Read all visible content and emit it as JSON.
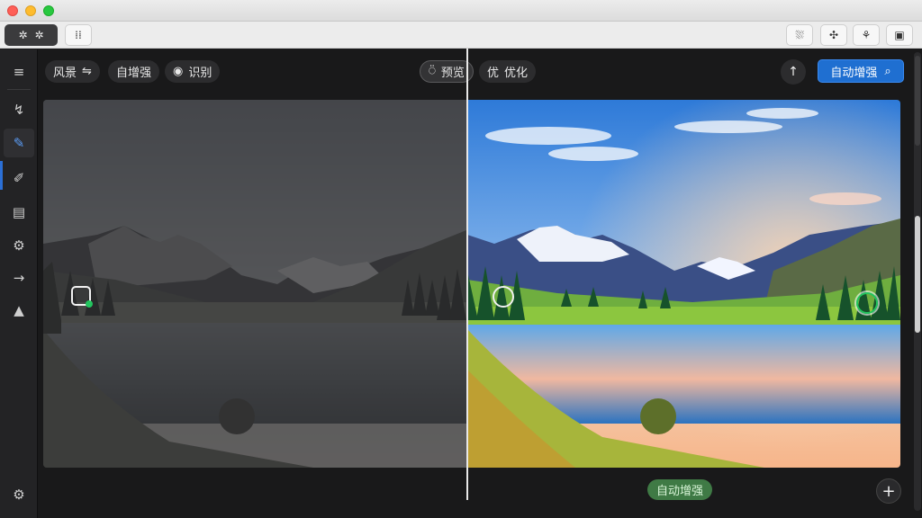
{
  "toolbar": {
    "group_icons": [
      "✲",
      "✲"
    ],
    "single_icon": "⁞⁞",
    "right_icons": [
      "⛆",
      "✣",
      "⚘",
      "▣"
    ]
  },
  "sidebar": {
    "items": [
      {
        "icon": "≡",
        "name": "menu-icon"
      },
      {
        "icon": "↯",
        "name": "adjust-icon"
      },
      {
        "icon": "✎",
        "name": "brush-icon"
      },
      {
        "icon": "✐",
        "name": "retouch-icon"
      },
      {
        "icon": "▤",
        "name": "layers-icon"
      },
      {
        "icon": "⚙",
        "name": "effects-icon"
      },
      {
        "icon": "→",
        "name": "export-icon"
      },
      {
        "icon": "▲",
        "name": "landscape-icon"
      }
    ],
    "settings_icon": "⚙"
  },
  "editor": {
    "scene_label": "风景",
    "scene_icon": "⇋",
    "enhance_label": "自增强",
    "recognize_icon": "◉",
    "recognize_label": "识别",
    "preview_icon": "⍥",
    "preview_label": "预览",
    "optimize_icon": "优",
    "optimize_label": "优化",
    "upload_icon": "↑",
    "auto_enhance_label": "自动增强",
    "search_icon": "⌕"
  },
  "status": {
    "pill_label": "自动增强",
    "add_icon": "+"
  },
  "colors": {
    "accent": "#1f6fd1",
    "success": "#3f7a45",
    "marker_green": "#22c55e"
  }
}
